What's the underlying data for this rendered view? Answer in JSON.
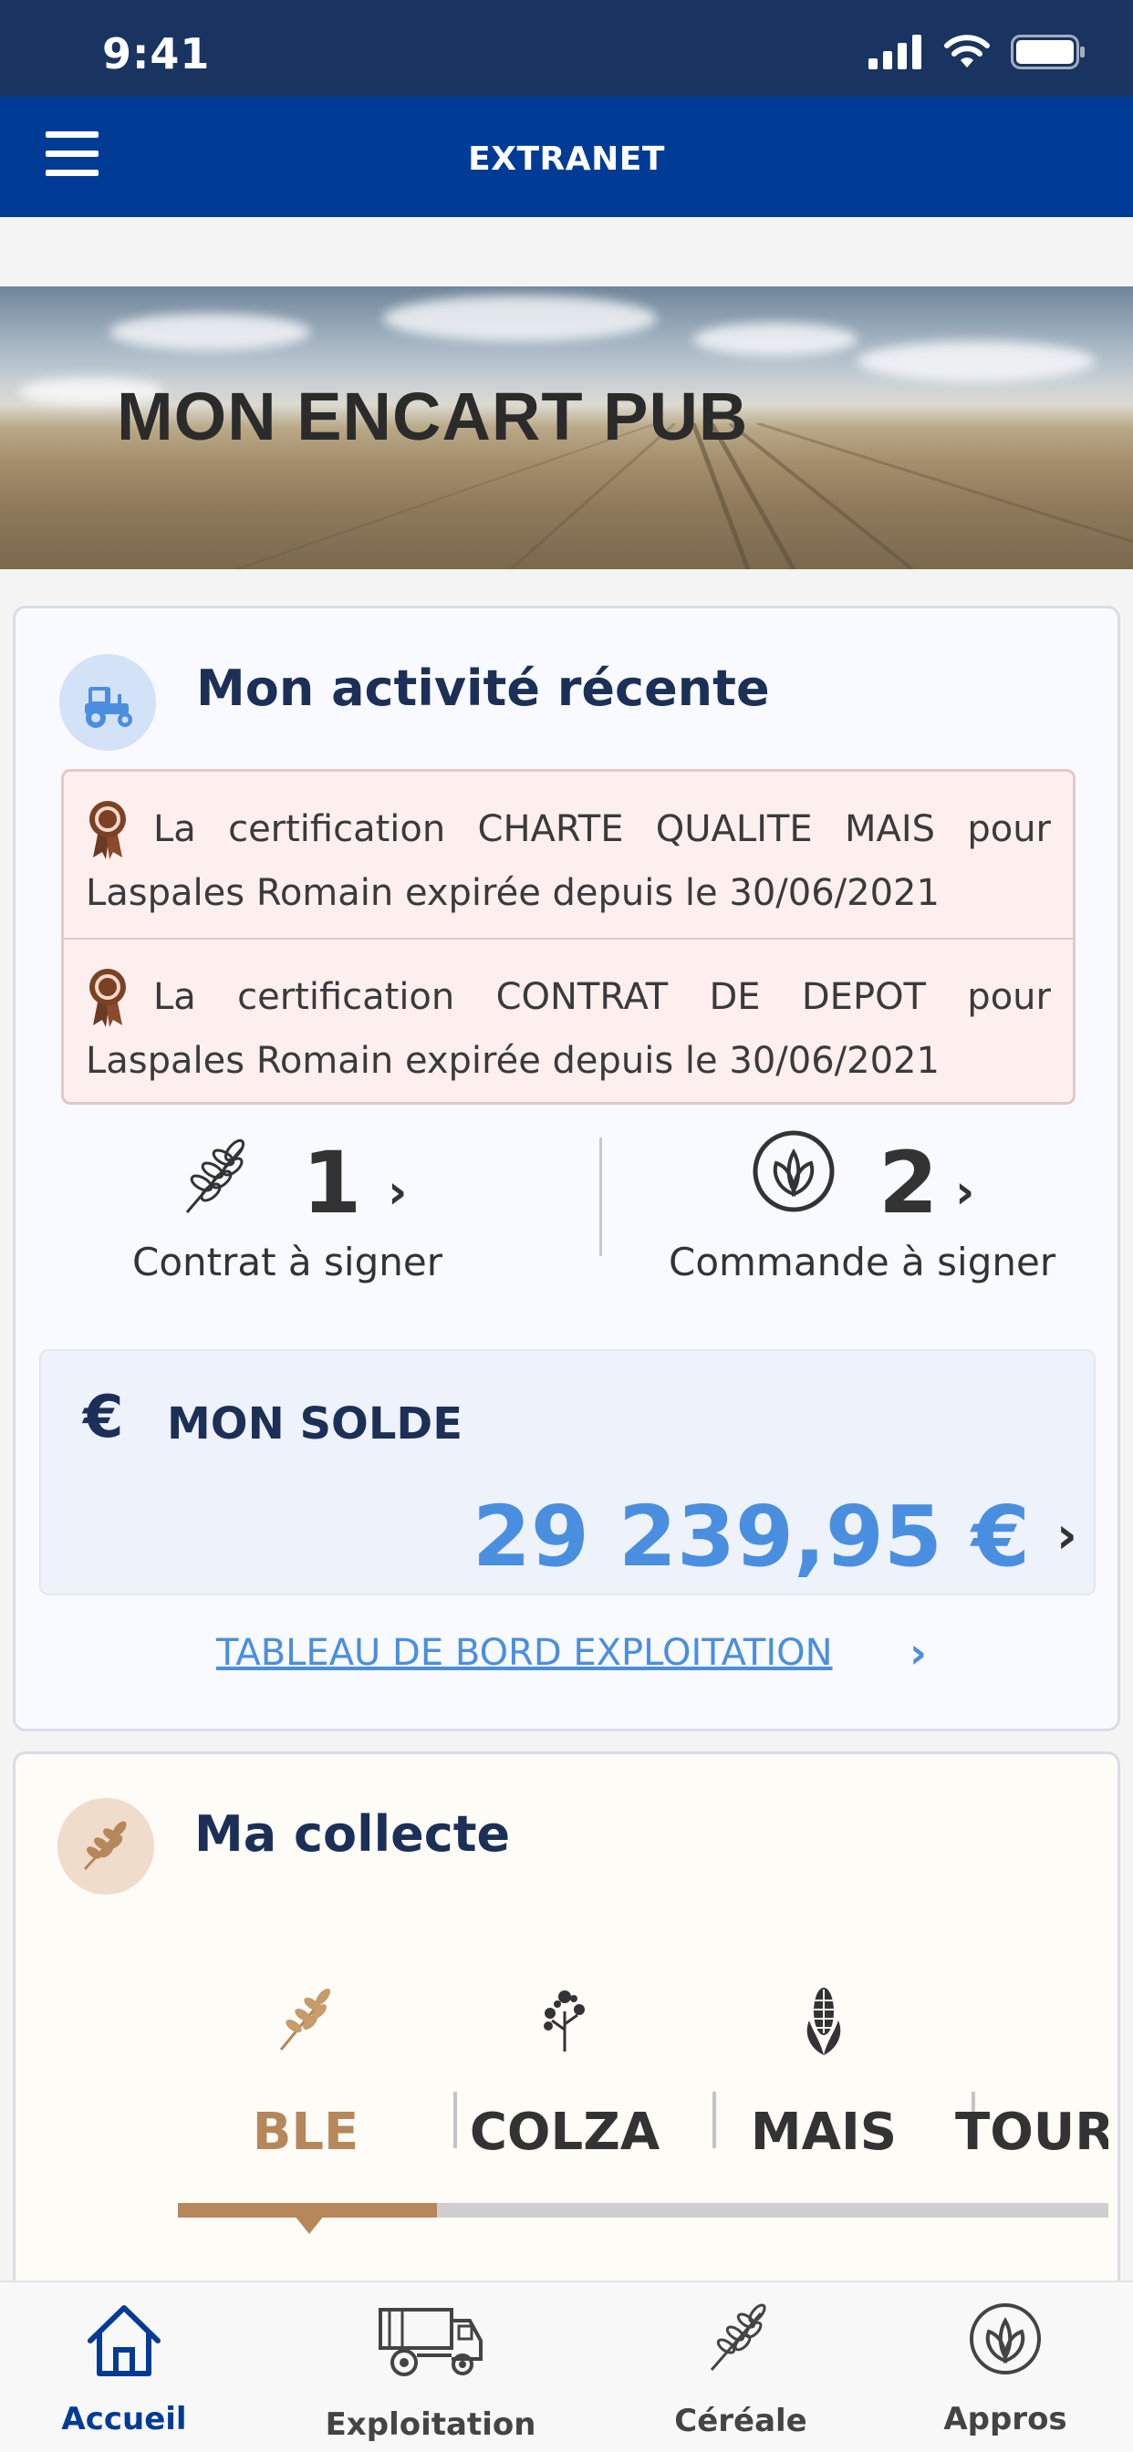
{
  "status_bar": {
    "time": "9:41"
  },
  "header": {
    "title": "EXTRANET"
  },
  "banner": {
    "title": "MON ENCART PUB"
  },
  "activity": {
    "title": "Mon activité récente",
    "alerts": [
      {
        "line1": [
          "La",
          "certification",
          "CHARTE",
          "QUALITE",
          "MAIS",
          "pour"
        ],
        "line2": "Laspales Romain expirée depuis le 30/06/2021"
      },
      {
        "line1": [
          "La",
          "certification",
          "CONTRAT",
          "DE",
          "DEPOT",
          "pour"
        ],
        "line2": "Laspales Romain expirée depuis le 30/06/2021"
      }
    ],
    "contracts": {
      "count": "1",
      "label": "Contrat à signer"
    },
    "orders": {
      "count": "2",
      "label": "Commande à signer"
    },
    "balance": {
      "label": "MON SOLDE",
      "amount": "29 239,95 €",
      "currency_symbol": "€"
    },
    "dashboard_link": "TABLEAU DE BORD EXPLOITATION"
  },
  "collecte": {
    "title": "Ma collecte",
    "crops": [
      {
        "label": "BLE",
        "selected": true
      },
      {
        "label": "COLZA",
        "selected": false
      },
      {
        "label": "MAIS",
        "selected": false
      },
      {
        "label": "TOUR",
        "selected": false
      }
    ]
  },
  "bottom_nav": [
    {
      "label": "Accueil",
      "active": true
    },
    {
      "label": "Exploitation",
      "active": false
    },
    {
      "label": "Céréale",
      "active": false
    },
    {
      "label": "Appros",
      "active": false
    }
  ],
  "colors": {
    "brand_blue": "#003b96",
    "status_bar": "#1a3462",
    "accent_blue": "#4a8ee0",
    "wheat": "#b5875a",
    "navy_text": "#1c2f57"
  }
}
